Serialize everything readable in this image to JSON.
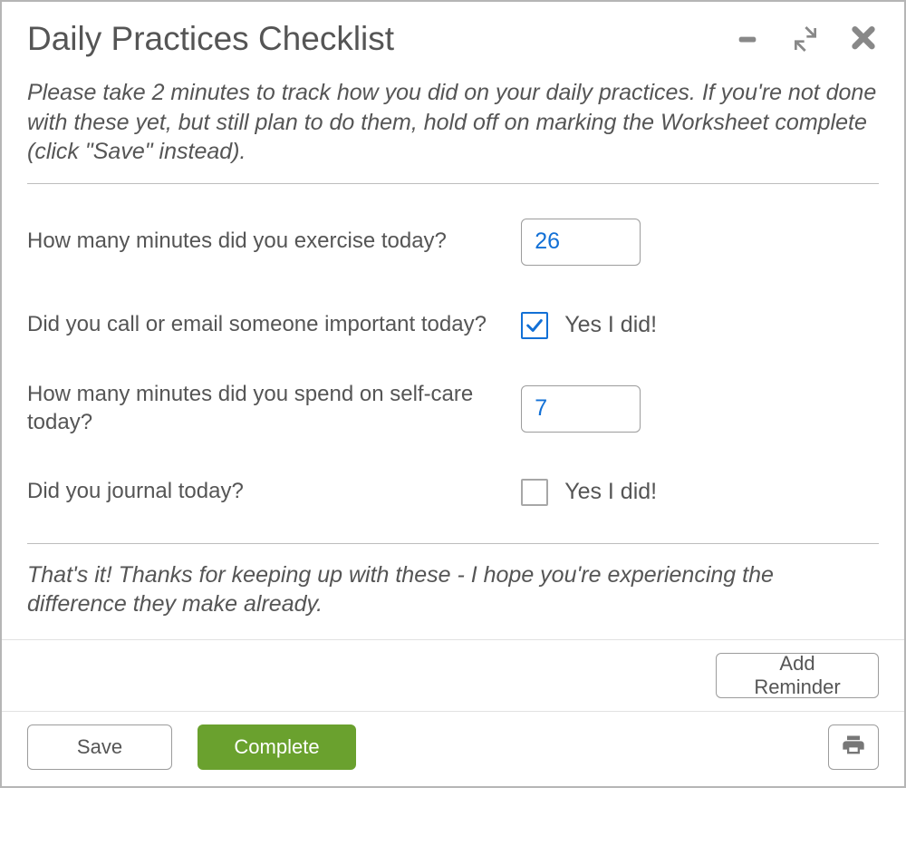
{
  "header": {
    "title": "Daily Practices Checklist"
  },
  "intro_text": "Please take 2 minutes to track how you did on your daily practices. If you're not done with these yet, but still plan to do them, hold off on marking the Worksheet complete (click \"Save\" instead).",
  "questions": [
    {
      "label": "How many minutes did you exercise today?",
      "type": "number",
      "value": "26"
    },
    {
      "label": "Did you call or email someone important today?",
      "type": "checkbox",
      "checked": true,
      "affirm": "Yes I did!"
    },
    {
      "label": "How many minutes did you spend on self-care today?",
      "type": "number",
      "value": "7"
    },
    {
      "label": "Did you journal today?",
      "type": "checkbox",
      "checked": false,
      "affirm": "Yes I did!"
    }
  ],
  "outro_text": "That's it! Thanks for keeping up with these - I hope you're experiencing the difference they make already.",
  "footer": {
    "add_reminder": "Add Reminder",
    "save": "Save",
    "complete": "Complete"
  }
}
